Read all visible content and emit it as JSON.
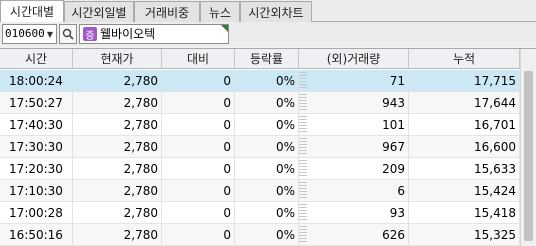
{
  "tabs": [
    {
      "label": "시간대별",
      "active": true
    },
    {
      "label": "시간외일별",
      "active": false
    },
    {
      "label": "거래비중",
      "active": false
    },
    {
      "label": "뉴스",
      "active": false
    },
    {
      "label": "시간외차트",
      "active": false
    }
  ],
  "toolbar": {
    "stock_code": "010600",
    "stock_badge": "증",
    "stock_name": "웰바이오텍"
  },
  "table": {
    "columns": [
      "시간",
      "현재가",
      "대비",
      "등락률",
      "(외)거래량",
      "누적"
    ],
    "rows": [
      {
        "time": "18:00:24",
        "price": "2,780",
        "change": "0",
        "rate": "0%",
        "volume": "71",
        "cumulative": "17,715"
      },
      {
        "time": "17:50:27",
        "price": "2,780",
        "change": "0",
        "rate": "0%",
        "volume": "943",
        "cumulative": "17,644"
      },
      {
        "time": "17:40:30",
        "price": "2,780",
        "change": "0",
        "rate": "0%",
        "volume": "101",
        "cumulative": "16,701"
      },
      {
        "time": "17:30:30",
        "price": "2,780",
        "change": "0",
        "rate": "0%",
        "volume": "967",
        "cumulative": "16,600"
      },
      {
        "time": "17:20:30",
        "price": "2,780",
        "change": "0",
        "rate": "0%",
        "volume": "209",
        "cumulative": "15,633"
      },
      {
        "time": "17:10:30",
        "price": "2,780",
        "change": "0",
        "rate": "0%",
        "volume": "6",
        "cumulative": "15,424"
      },
      {
        "time": "17:00:28",
        "price": "2,780",
        "change": "0",
        "rate": "0%",
        "volume": "93",
        "cumulative": "15,418"
      },
      {
        "time": "16:50:16",
        "price": "2,780",
        "change": "0",
        "rate": "0%",
        "volume": "626",
        "cumulative": "15,325"
      }
    ]
  },
  "colors": {
    "selected_row": "#cce8f4",
    "badge": "#a05ac8"
  }
}
